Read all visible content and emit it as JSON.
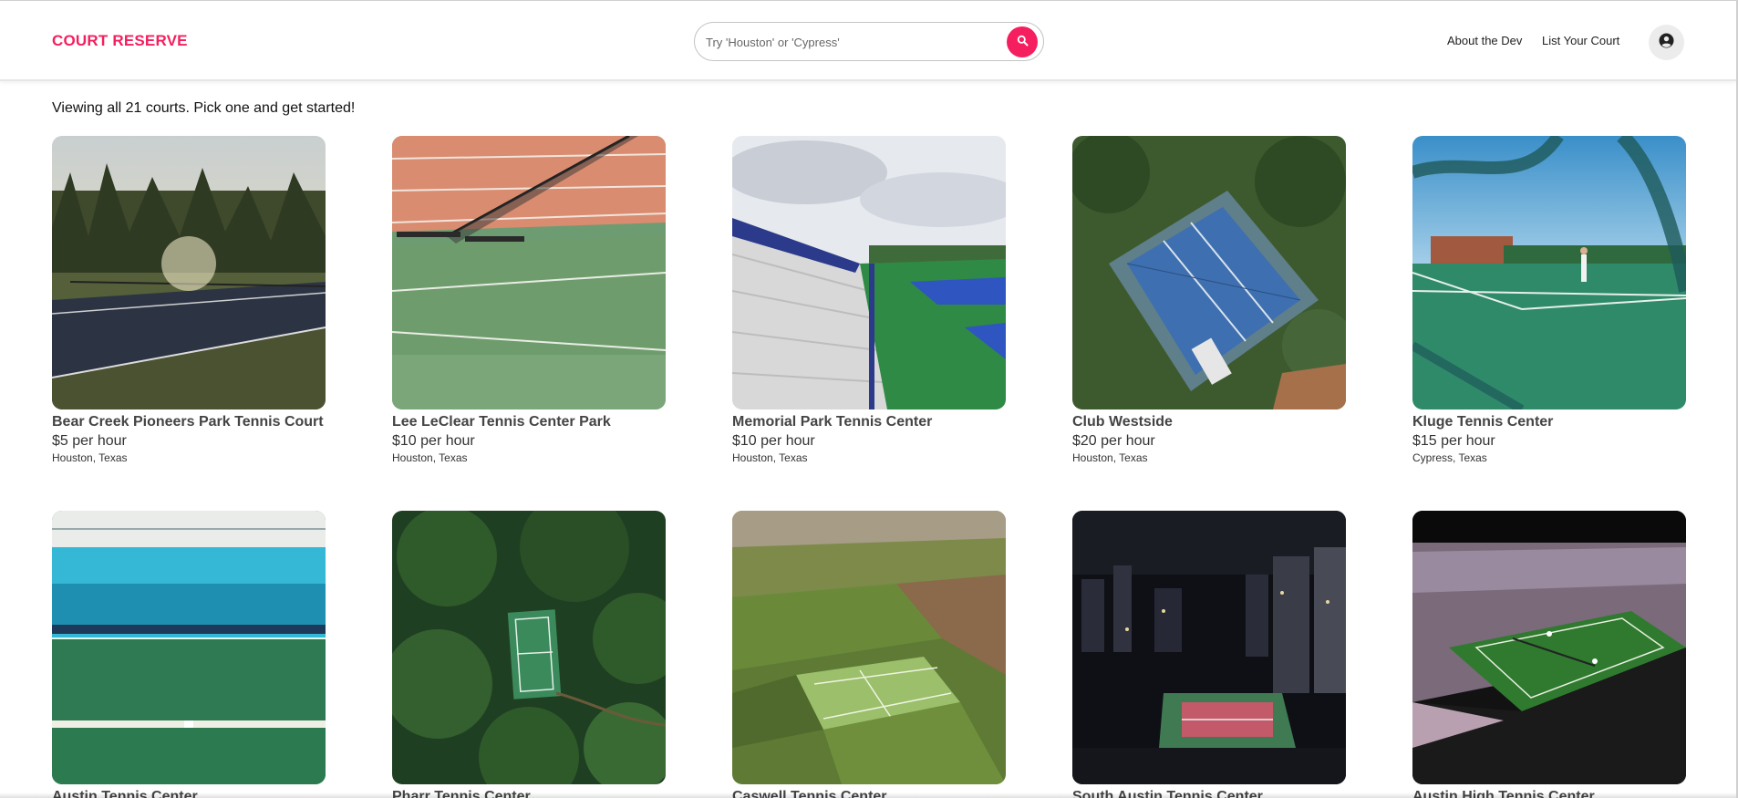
{
  "brand": {
    "name": "COURT RESERVE",
    "accent": "#f51f5f"
  },
  "search": {
    "placeholder": "Try 'Houston' or 'Cypress'",
    "value": ""
  },
  "nav": {
    "about_label": "About the Dev",
    "list_label": "List Your Court"
  },
  "icons": {
    "search": "search-icon",
    "user": "user-circle-icon"
  },
  "summary_text": "Viewing all 21 courts. Pick one and get started!",
  "courts": [
    {
      "name": "Bear Creek Pioneers Park Tennis Court",
      "price": "$5 per hour",
      "location": "Houston, Texas"
    },
    {
      "name": "Lee LeClear Tennis Center Park",
      "price": "$10 per hour",
      "location": "Houston, Texas"
    },
    {
      "name": "Memorial Park Tennis Center",
      "price": "$10 per hour",
      "location": "Houston, Texas"
    },
    {
      "name": "Club Westside",
      "price": "$20 per hour",
      "location": "Houston, Texas"
    },
    {
      "name": "Kluge Tennis Center",
      "price": "$15 per hour",
      "location": "Cypress, Texas"
    },
    {
      "name": "Austin Tennis Center",
      "price": "",
      "location": ""
    },
    {
      "name": "Pharr Tennis Center",
      "price": "",
      "location": ""
    },
    {
      "name": "Caswell Tennis Center",
      "price": "",
      "location": ""
    },
    {
      "name": "South Austin Tennis Center",
      "price": "",
      "location": ""
    },
    {
      "name": "Austin High Tennis Center",
      "price": "",
      "location": ""
    }
  ]
}
